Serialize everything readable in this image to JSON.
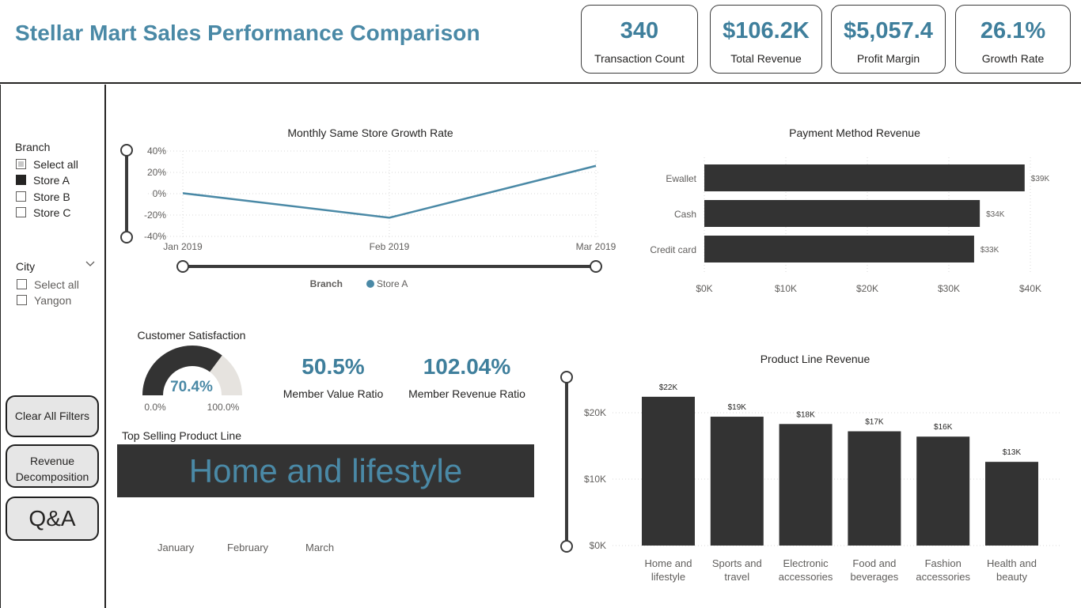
{
  "header": {
    "title": "Stellar Mart Sales Performance Comparison",
    "kpis": [
      {
        "value": "340",
        "label": "Transaction Count"
      },
      {
        "value": "$106.2K",
        "label": "Total Revenue"
      },
      {
        "value": "$5,057.4",
        "label": "Profit Margin"
      },
      {
        "value": "26.1%",
        "label": "Growth Rate"
      }
    ]
  },
  "sidebar": {
    "branch": {
      "title": "Branch",
      "items": [
        {
          "label": "Select all",
          "state": "partial"
        },
        {
          "label": "Store A",
          "state": "checked"
        },
        {
          "label": "Store B",
          "state": "unchecked"
        },
        {
          "label": "Store C",
          "state": "unchecked"
        }
      ]
    },
    "city": {
      "title": "City",
      "items": [
        {
          "label": "Select all",
          "state": "unchecked"
        },
        {
          "label": "Yangon",
          "state": "unchecked"
        }
      ]
    },
    "buttons": {
      "clear_filters": "Clear All Filters",
      "revenue_decomp_line1": "Revenue",
      "revenue_decomp_line2": "Decomposition",
      "qa": "Q&A"
    }
  },
  "growth_chart": {
    "title": "Monthly Same Store Growth Rate",
    "legend_title": "Branch",
    "legend_item": "Store A",
    "y_ticks": [
      "40%",
      "20%",
      "0%",
      "-20%",
      "-40%"
    ],
    "x_ticks": [
      "Jan 2019",
      "Feb 2019",
      "Mar 2019"
    ]
  },
  "payment_chart": {
    "title": "Payment Method Revenue",
    "x_ticks": [
      "$0K",
      "$10K",
      "$20K",
      "$30K",
      "$40K"
    ]
  },
  "satisfaction": {
    "title": "Customer Satisfaction",
    "value": "70.4%",
    "min": "0.0%",
    "max": "100.0%",
    "fraction": 0.704
  },
  "ratios": {
    "member_value": {
      "value": "50.5%",
      "label": "Member Value Ratio"
    },
    "member_revenue": {
      "value": "102.04%",
      "label": "Member Revenue Ratio"
    }
  },
  "top_selling": {
    "title": "Top Selling Product Line",
    "value": "Home and lifestyle",
    "months": [
      "January",
      "February",
      "March"
    ]
  },
  "product_chart": {
    "title": "Product Line Revenue",
    "y_ticks": [
      "$20K",
      "$10K",
      "$0K"
    ]
  },
  "colors": {
    "accent": "#4a89a6",
    "dark": "#333333",
    "gauge_empty": "#e6e3df"
  },
  "chart_data": [
    {
      "type": "line",
      "title": "Monthly Same Store Growth Rate",
      "x": [
        "Jan 2019",
        "Feb 2019",
        "Mar 2019"
      ],
      "series": [
        {
          "name": "Store A",
          "values": [
            0.5,
            -22.5,
            26.1
          ]
        }
      ],
      "ylim": [
        -40,
        40
      ],
      "ylabel": "",
      "xlabel": "",
      "grid": true,
      "legend": "bottom"
    },
    {
      "type": "bar",
      "orientation": "horizontal",
      "title": "Payment Method Revenue",
      "categories": [
        "Ewallet",
        "Cash",
        "Credit card"
      ],
      "values": [
        39.3,
        33.8,
        33.1
      ],
      "labels": [
        "$39K",
        "$34K",
        "$33K"
      ],
      "xlim": [
        0,
        40
      ],
      "grid": true
    },
    {
      "type": "bar",
      "title": "Product Line Revenue",
      "categories": [
        [
          "Home and",
          "lifestyle"
        ],
        [
          "Sports and",
          "travel"
        ],
        [
          "Electronic",
          "accessories"
        ],
        [
          "Food and",
          "beverages"
        ],
        [
          "Fashion",
          "accessories"
        ],
        [
          "Health and",
          "beauty"
        ]
      ],
      "values": [
        22.4,
        19.4,
        18.3,
        17.2,
        16.4,
        12.6
      ],
      "labels": [
        "$22K",
        "$19K",
        "$18K",
        "$17K",
        "$16K",
        "$13K"
      ],
      "ylim": [
        0,
        25
      ],
      "grid": true
    }
  ]
}
